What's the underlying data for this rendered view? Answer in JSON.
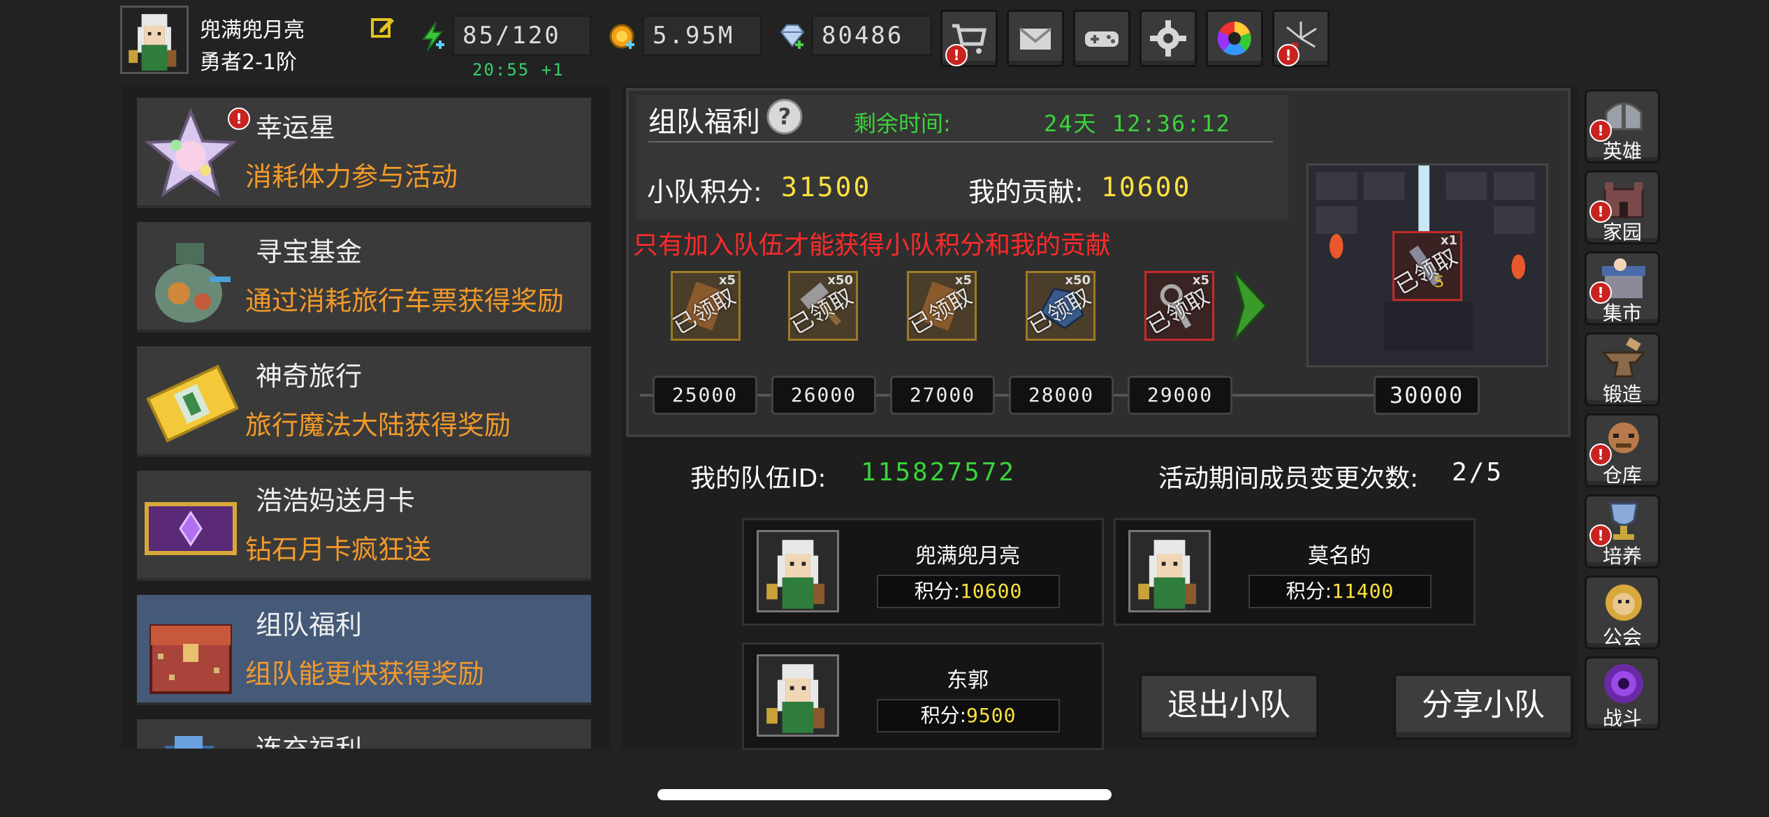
{
  "player": {
    "name": "兜满兜月亮",
    "rank": "勇者2-1阶",
    "stamina": "85/120",
    "stamina_timer": "20:55 +1",
    "gold": "5.95M",
    "diamonds": "80486"
  },
  "top_buttons": [
    "shop-cart-icon",
    "mail-icon",
    "gamepad-icon",
    "gear-icon",
    "color-wheel-icon",
    "fireworks-icon"
  ],
  "activities": [
    {
      "title": "幸运星",
      "subtitle": "消耗体力参与活动",
      "icon": "lucky-star-icon"
    },
    {
      "title": "寻宝基金",
      "subtitle": "通过消耗旅行车票获得奖励",
      "icon": "treasure-bag-icon"
    },
    {
      "title": "神奇旅行",
      "subtitle": "旅行魔法大陆获得奖励",
      "icon": "travel-ticket-icon"
    },
    {
      "title": "浩浩妈送月卡",
      "subtitle": "钻石月卡疯狂送",
      "icon": "month-card-icon"
    },
    {
      "title": "组队福利",
      "subtitle": "组队能更快获得奖励",
      "icon": "team-chest-icon"
    },
    {
      "title": "连充福利",
      "subtitle": "",
      "icon": "recharge-icon"
    }
  ],
  "team_benefit": {
    "title": "组队福利",
    "remaining_label": "剩余时间:",
    "remaining_value": "24天 12:36:12",
    "team_score_label": "小队积分:",
    "team_score": "31500",
    "my_contribution_label": "我的贡献:",
    "my_contribution": "10600",
    "warning": "只有加入队伍才能获得小队积分和我的贡献",
    "rewards": [
      {
        "count": "x5",
        "status": "已领取"
      },
      {
        "count": "x50",
        "status": "已领取"
      },
      {
        "count": "x5",
        "status": "已领取"
      },
      {
        "count": "x50",
        "status": "已领取"
      },
      {
        "count": "x5",
        "status": "已领取"
      }
    ],
    "thresholds": [
      "25000",
      "26000",
      "27000",
      "28000",
      "29000"
    ],
    "final_threshold": "30000",
    "final_reward": {
      "count": "x1",
      "status": "已领取"
    }
  },
  "team": {
    "id_label": "我的队伍ID:",
    "id": "115827572",
    "change_label": "活动期间成员变更次数:",
    "change_value": "2/5",
    "score_label": "积分:",
    "members": [
      {
        "name": "兜满兜月亮",
        "score": "10600"
      },
      {
        "name": "莫名的",
        "score": "11400"
      },
      {
        "name": "东郭",
        "score": "9500"
      }
    ],
    "quit_button": "退出小队",
    "share_button": "分享小队"
  },
  "right_nav": [
    {
      "label": "英雄",
      "icon": "helmet-icon",
      "alert": true
    },
    {
      "label": "家园",
      "icon": "castle-icon",
      "alert": true
    },
    {
      "label": "集市",
      "icon": "market-icon",
      "alert": true
    },
    {
      "label": "锻造",
      "icon": "anvil-icon",
      "alert": false
    },
    {
      "label": "仓库",
      "icon": "warehouse-icon",
      "alert": true
    },
    {
      "label": "培养",
      "icon": "trophy-icon",
      "alert": true
    },
    {
      "label": "公会",
      "icon": "guild-icon",
      "alert": false
    },
    {
      "label": "战斗",
      "icon": "portal-icon",
      "alert": false
    }
  ],
  "colors": {
    "accent_orange": "#f29a2a",
    "green_text": "#3bd33b",
    "yellow_value": "#ffe23d",
    "warning_red": "#ff2a2a",
    "active_card": "#455a78"
  }
}
